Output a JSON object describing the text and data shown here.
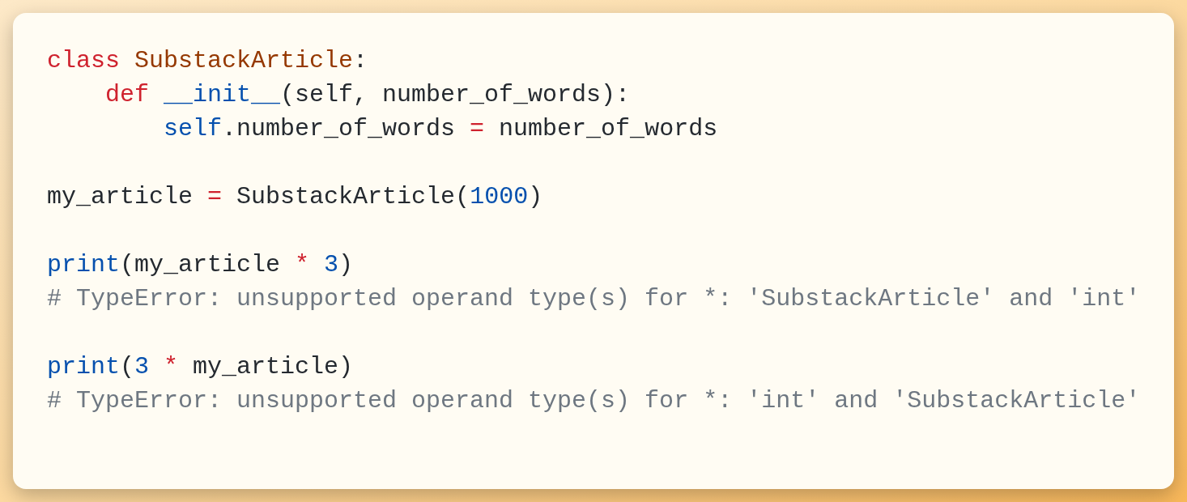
{
  "code_lines": [
    {
      "kind": "code",
      "tokens": [
        {
          "text": "class ",
          "kind": "keyword"
        },
        {
          "text": "SubstackArticle",
          "kind": "class_name"
        },
        {
          "text": ":",
          "kind": "plain"
        }
      ],
      "children": [
        {
          "kind": "code",
          "tokens": [
            {
              "text": "def ",
              "kind": "keyword"
            },
            {
              "text": "__init__",
              "kind": "builtin"
            },
            {
              "text": "(self, number_of_words):",
              "kind": "plain"
            }
          ],
          "children": [
            {
              "kind": "code",
              "tokens": [
                {
                  "text": "self",
                  "kind": "builtin"
                },
                {
                  "text": ".number_of_words ",
                  "kind": "plain"
                },
                {
                  "text": "=",
                  "kind": "operator"
                },
                {
                  "text": " number_of_words",
                  "kind": "plain"
                }
              ]
            }
          ]
        }
      ]
    },
    {
      "kind": "blank"
    },
    {
      "kind": "code",
      "tokens": [
        {
          "text": "my_article ",
          "kind": "plain"
        },
        {
          "text": "=",
          "kind": "operator"
        },
        {
          "text": " SubstackArticle(",
          "kind": "plain"
        },
        {
          "text": "1000",
          "kind": "number"
        },
        {
          "text": ")",
          "kind": "plain"
        }
      ]
    },
    {
      "kind": "blank"
    },
    {
      "kind": "code",
      "tokens": [
        {
          "text": "print",
          "kind": "builtin"
        },
        {
          "text": "(my_article ",
          "kind": "plain"
        },
        {
          "text": "* ",
          "kind": "operator"
        },
        {
          "text": "3",
          "kind": "number"
        },
        {
          "text": ")",
          "kind": "plain"
        }
      ]
    },
    {
      "kind": "code",
      "tokens": [
        {
          "text": "# TypeError: unsupported operand type(s) for *: 'SubstackArticle' and 'int'",
          "kind": "comment"
        }
      ]
    },
    {
      "kind": "blank"
    },
    {
      "kind": "code",
      "tokens": [
        {
          "text": "print",
          "kind": "builtin"
        },
        {
          "text": "(",
          "kind": "plain"
        },
        {
          "text": "3 ",
          "kind": "number"
        },
        {
          "text": "*",
          "kind": "operator"
        },
        {
          "text": " my_article)",
          "kind": "plain"
        }
      ]
    },
    {
      "kind": "code",
      "tokens": [
        {
          "text": "# TypeError: unsupported operand type(s) for *: 'int' and 'SubstackArticle'",
          "kind": "comment"
        }
      ]
    }
  ]
}
